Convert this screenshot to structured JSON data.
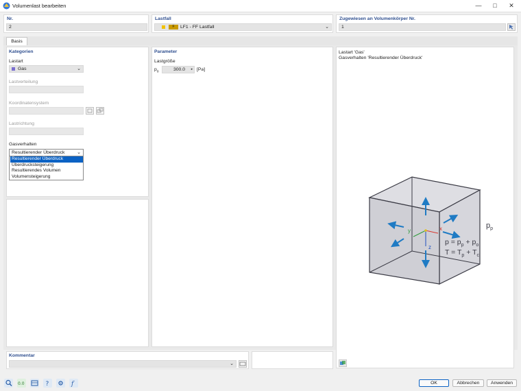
{
  "window": {
    "title": "Volumenlast bearbeiten",
    "min_icon": "minimize-icon",
    "max_icon": "maximize-icon",
    "close_icon": "close-icon"
  },
  "header": {
    "nr": {
      "label": "Nr.",
      "value": "2"
    },
    "lastfall": {
      "label": "Lastfall",
      "color": "#f2b800",
      "badge": "F",
      "value": "LF1 - FF Lastfall"
    },
    "assigned": {
      "label": "Zugewiesen an Volumenkörper Nr.",
      "value": "1"
    }
  },
  "tabs": [
    {
      "label": "Basis"
    }
  ],
  "kategorien": {
    "title": "Kategorien",
    "lastart": {
      "label": "Lastart",
      "value": "Gas",
      "color": "#7b6fd0"
    },
    "lastverteilung": {
      "label": "Lastverteilung"
    },
    "koordinatensystem": {
      "label": "Koordinatensystem"
    },
    "lastrichtung": {
      "label": "Lastrichtung"
    },
    "gasverhalten": {
      "label": "Gasverhalten",
      "value": "Resultierender Überdruck",
      "options": [
        "Resultierender Überdruck",
        "Überdrucksteigerung",
        "Resultierendes Volumen",
        "Volumensteigerung"
      ]
    }
  },
  "parameter": {
    "title": "Parameter",
    "lastgroesse": "Lastgröße",
    "symbol_base": "p",
    "symbol_sub": "o",
    "value": "300.0",
    "unit": "[Pa]"
  },
  "preview": {
    "line1": "Lastart 'Gas'",
    "line2": "Gasverhalten 'Resultierender Überdruck'",
    "axis_x": "x",
    "axis_y": "y",
    "axis_z": "z",
    "pp_main": "p",
    "pp_sub": "p",
    "eq1_a": "p = p",
    "eq1_b": "p",
    "eq1_c": " + p",
    "eq1_d": "o",
    "eq2_a": "T = T",
    "eq2_b": "p",
    "eq2_c": " + T",
    "eq2_d": "c"
  },
  "kommentar": {
    "label": "Kommentar"
  },
  "buttons": {
    "ok": "OK",
    "cancel": "Abbrechen",
    "apply": "Anwenden"
  }
}
